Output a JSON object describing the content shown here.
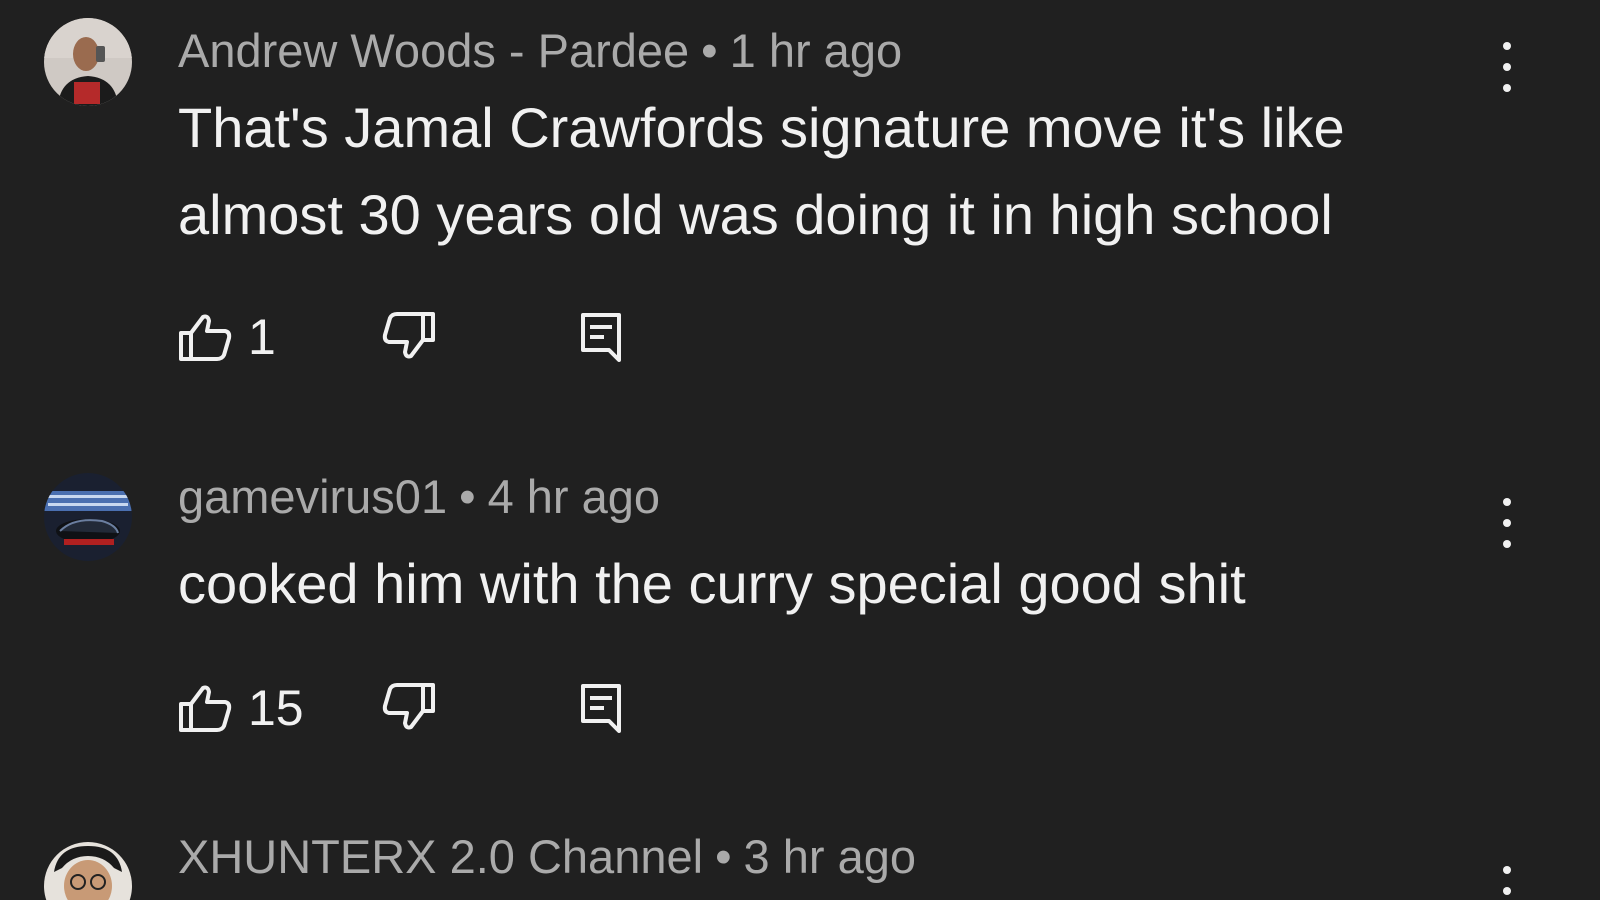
{
  "comments": [
    {
      "author": "Andrew Woods - Pardee",
      "time": "1 hr ago",
      "text": "That's Jamal Crawfords signature move it's like almost 30 years old was doing it in high school",
      "likes": "1"
    },
    {
      "author": "gamevirus01",
      "time": "4 hr ago",
      "text": "cooked him with the curry special good shit",
      "likes": "15"
    },
    {
      "author": "XHUNTERX 2.0 Channel",
      "time": "3 hr ago"
    }
  ],
  "separator": "•",
  "icons": {
    "like": "thumb-up-icon",
    "dislike": "thumb-down-icon",
    "reply": "reply-comment-icon",
    "menu": "more-vert-icon"
  },
  "colors": {
    "background": "#202020",
    "meta_text": "#aaaaaa",
    "body_text": "#f1f1f1"
  }
}
